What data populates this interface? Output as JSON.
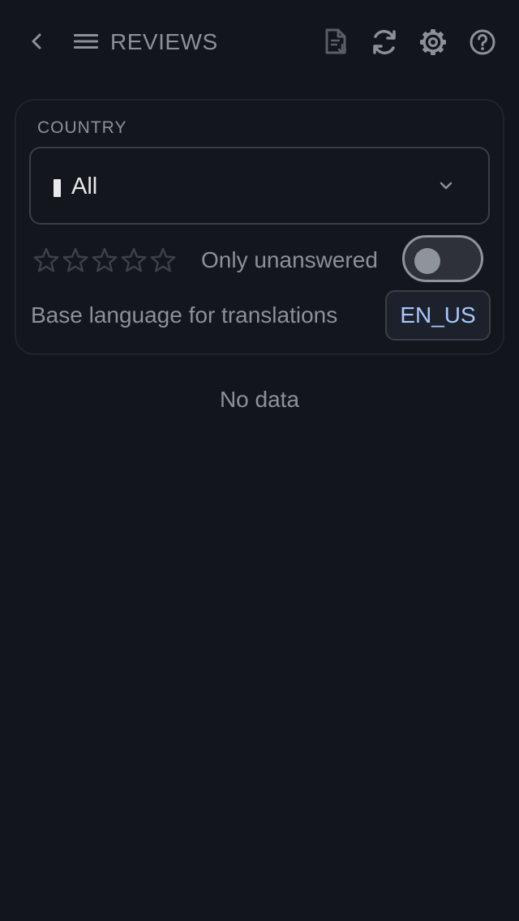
{
  "header": {
    "title": "REVIEWS",
    "icons": [
      "back-arrow-icon",
      "menu-icon",
      "export-file-icon",
      "refresh-icon",
      "gear-icon",
      "help-icon"
    ]
  },
  "filters": {
    "country_label": "COUNTRY",
    "country_value": "All",
    "rating_stars": 5,
    "rating_selected": 0,
    "only_unanswered_label": "Only unanswered",
    "only_unanswered": false,
    "base_language_label": "Base language for translations",
    "base_language_value": "EN_US"
  },
  "empty_state": {
    "message": "No data"
  },
  "colors": {
    "background": "#12151b",
    "text_muted": "#8d9099",
    "accent": "#a8c7ff"
  }
}
